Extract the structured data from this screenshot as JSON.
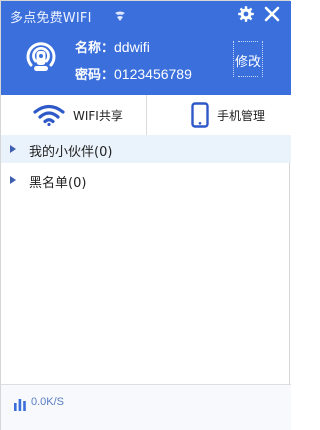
{
  "app": {
    "title": "多点免费WIFI"
  },
  "wifi": {
    "name_label": "名称：",
    "name_value": "ddwifi",
    "password_label": "密码：",
    "password_value": "0123456789",
    "edit_label": "修改"
  },
  "tabs": [
    {
      "label": "WIFI共享",
      "icon": "wifi-icon",
      "active": true
    },
    {
      "label": "手机管理",
      "icon": "phone-icon",
      "active": false
    }
  ],
  "groups": [
    {
      "label": "我的小伙伴(0)",
      "selected": true
    },
    {
      "label": "黑名单(0)",
      "selected": false
    }
  ],
  "status": {
    "speed": "0.0K/S"
  },
  "colors": {
    "header_bg": "#3a6fdc",
    "accent_blue": "#2f59c8",
    "selected_row": "#eaf2fb"
  }
}
